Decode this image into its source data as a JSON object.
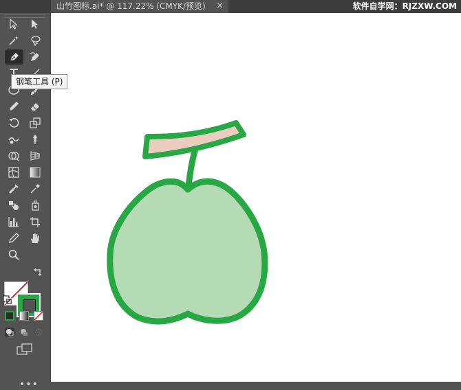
{
  "tab": {
    "title": "山竹图标.ai* @ 117.22% (CMYK/预览)",
    "close_glyph": "×"
  },
  "watermark": "软件自学网：RJZXW.COM",
  "tooltip": {
    "text": "钢笔工具 (P)"
  },
  "toolbar": {
    "tools": [
      "selection-tool",
      "direct-selection-tool",
      "magic-wand-tool",
      "lasso-tool",
      "pen-tool",
      "curvature-tool",
      "type-tool",
      "line-tool",
      "ellipse-tool",
      "paintbrush-tool",
      "pencil-tool",
      "eraser-tool",
      "rotate-tool",
      "scale-tool",
      "warp-tool",
      "puppet-warp-tool",
      "shape-builder-tool",
      "perspective-grid-tool",
      "mesh-tool",
      "gradient-tool",
      "eyedropper-tool",
      "eyedropper-tool",
      "blend-tool",
      "symbol-sprayer-tool",
      "column-graph-tool",
      "artboard-tool",
      "slice-tool",
      "hand-tool",
      "zoom-tool"
    ],
    "active_tool": "pen-tool",
    "fill": {
      "state": "none",
      "color": "#ffffff"
    },
    "stroke": {
      "color": "#27a844"
    }
  },
  "artwork": {
    "fruit_fill": "#b5dbb5",
    "outline_color": "#27a844",
    "leaf_fill": "#ebcdc0"
  }
}
